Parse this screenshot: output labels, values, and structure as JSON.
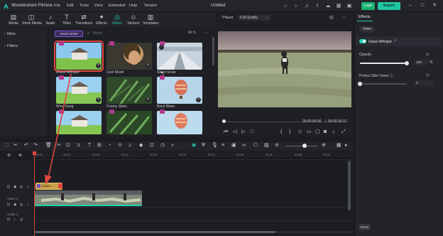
{
  "app": {
    "name": "Wondershare Filmora",
    "doc_title": "Untitled"
  },
  "menu": [
    "File",
    "Edit",
    "Tools",
    "View",
    "Extended",
    "Help",
    "Version"
  ],
  "header": {
    "login_label": "Login",
    "export_label": "Export"
  },
  "toolbar": [
    {
      "label": "Media",
      "icon": "media-icon"
    },
    {
      "label": "Stock Media",
      "icon": "stock-media-icon"
    },
    {
      "label": "Audio",
      "icon": "audio-icon"
    },
    {
      "label": "Titles",
      "icon": "titles-icon"
    },
    {
      "label": "Transitions",
      "icon": "transitions-icon"
    },
    {
      "label": "Effects",
      "icon": "effects-icon"
    },
    {
      "label": "Filters",
      "icon": "filters-icon"
    },
    {
      "label": "Stickers",
      "icon": "stickers-icon"
    },
    {
      "label": "Templates",
      "icon": "templates-icon"
    }
  ],
  "left_panel": {
    "items": [
      "Mine",
      "Filters"
    ]
  },
  "browser": {
    "asset_center_label": "Asset Center",
    "search_placeholder": "Mood",
    "filter_label": "All",
    "thumbs": [
      {
        "label": "Grass Whisper"
      },
      {
        "label": "Cool Mood"
      },
      {
        "label": "Silent Snow"
      },
      {
        "label": "Wind Song"
      },
      {
        "label": "Foamy Skies"
      },
      {
        "label": "Beryl Blaze"
      },
      {
        "label": ""
      },
      {
        "label": ""
      },
      {
        "label": ""
      }
    ]
  },
  "player": {
    "label": "Player",
    "quality": "Full Quality",
    "time_current": "00:00:00:00",
    "time_total": "00:00:18:37"
  },
  "right_panel": {
    "tab": "Effects",
    "subtab": "Video",
    "effect_name": "Grass Whisper",
    "opacity_label": "Opacity",
    "opacity_value": "100",
    "opacity_unit": "%",
    "opacity_level": 1.0,
    "protect_label": "Protect Skin Tones",
    "protect_value": "0",
    "protect_level": 0.0,
    "reset_label": "Reset"
  },
  "timeline": {
    "ticks": [
      "00:00",
      "00:04",
      "00:08",
      "00:12",
      "00:16",
      "00:20",
      "00:24",
      "00:28",
      "00:32",
      "00:36",
      "00:40"
    ],
    "effect_clip_label": "Grass ...",
    "track_labels": [
      "Video 1",
      "Audio 1"
    ]
  },
  "colors": {
    "accent": "#22d0b3",
    "export": "#1fc7a3",
    "login": "#18b16e",
    "selection": "#e0453c"
  }
}
